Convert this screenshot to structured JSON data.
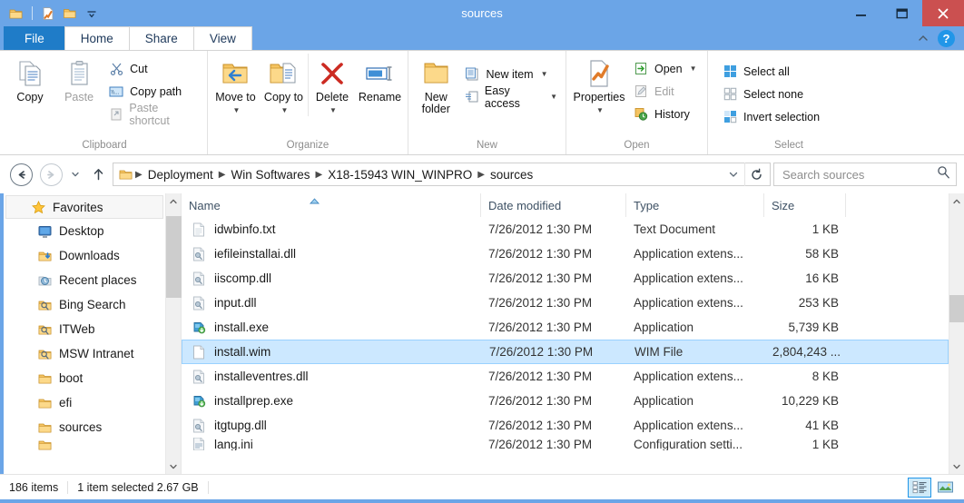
{
  "window": {
    "title": "sources",
    "quick_access": [
      "folder-icon",
      "properties-icon",
      "new-folder-icon",
      "qat-dropdown-icon"
    ],
    "controls": {
      "minimize": "minimize-icon",
      "maximize": "maximize-icon",
      "close": "close-icon"
    }
  },
  "ribbon": {
    "tabs": [
      {
        "label": "File",
        "active": false
      },
      {
        "label": "Home",
        "active": true
      },
      {
        "label": "Share",
        "active": false
      },
      {
        "label": "View",
        "active": false
      }
    ],
    "collapse_icon": "chevron-up-icon",
    "help_icon": "question-mark-icon",
    "groups": {
      "clipboard": {
        "label": "Clipboard",
        "copy": "Copy",
        "paste": "Paste",
        "cut": "Cut",
        "copy_path": "Copy path",
        "paste_shortcut": "Paste shortcut"
      },
      "organize": {
        "label": "Organize",
        "move_to": "Move to",
        "copy_to": "Copy to",
        "delete": "Delete",
        "rename": "Rename"
      },
      "new": {
        "label": "New",
        "new_folder": "New folder",
        "new_item": "New item",
        "easy_access": "Easy access"
      },
      "open": {
        "label": "Open",
        "properties": "Properties",
        "open": "Open",
        "edit": "Edit",
        "history": "History"
      },
      "select": {
        "label": "Select",
        "select_all": "Select all",
        "select_none": "Select none",
        "invert_selection": "Invert selection"
      }
    }
  },
  "address_bar": {
    "back": "back-icon",
    "forward": "forward-icon",
    "recent_dropdown": "history-dropdown-icon",
    "up": "up-icon",
    "breadcrumbs": [
      "Deployment",
      "Win Softwares",
      "X18-15943 WIN_WINPRO",
      "sources"
    ],
    "dropdown_icon": "chevron-down-icon",
    "refresh_icon": "refresh-icon",
    "search": {
      "placeholder": "Search sources",
      "value": "",
      "icon": "search-icon"
    }
  },
  "nav_pane": {
    "items": [
      {
        "label": "Favorites",
        "icon": "star-icon",
        "level": "root"
      },
      {
        "label": "Desktop",
        "icon": "desktop-icon",
        "level": "child"
      },
      {
        "label": "Downloads",
        "icon": "downloads-folder-icon",
        "level": "child"
      },
      {
        "label": "Recent places",
        "icon": "recent-places-icon",
        "level": "child"
      },
      {
        "label": "Bing Search",
        "icon": "search-folder-icon",
        "level": "child"
      },
      {
        "label": "ITWeb",
        "icon": "search-folder-icon",
        "level": "child"
      },
      {
        "label": "MSW Intranet",
        "icon": "search-folder-icon",
        "level": "child"
      },
      {
        "label": "boot",
        "icon": "folder-icon",
        "level": "child"
      },
      {
        "label": "efi",
        "icon": "folder-icon",
        "level": "child"
      },
      {
        "label": "sources",
        "icon": "folder-icon",
        "level": "child"
      }
    ]
  },
  "file_list": {
    "columns": [
      "Name",
      "Date modified",
      "Type",
      "Size"
    ],
    "sort": {
      "column": "Name",
      "direction": "ascending"
    },
    "rows": [
      {
        "name": "idwbinfo.txt",
        "date": "7/26/2012 1:30 PM",
        "type": "Text Document",
        "size": "1 KB",
        "icon": "text-file-icon",
        "selected": false
      },
      {
        "name": "iefileinstallai.dll",
        "date": "7/26/2012 1:30 PM",
        "type": "Application extens...",
        "size": "58 KB",
        "icon": "dll-file-icon",
        "selected": false
      },
      {
        "name": "iiscomp.dll",
        "date": "7/26/2012 1:30 PM",
        "type": "Application extens...",
        "size": "16 KB",
        "icon": "dll-file-icon",
        "selected": false
      },
      {
        "name": "input.dll",
        "date": "7/26/2012 1:30 PM",
        "type": "Application extens...",
        "size": "253 KB",
        "icon": "dll-file-icon",
        "selected": false
      },
      {
        "name": "install.exe",
        "date": "7/26/2012 1:30 PM",
        "type": "Application",
        "size": "5,739 KB",
        "icon": "exe-file-icon",
        "selected": false
      },
      {
        "name": "install.wim",
        "date": "7/26/2012 1:30 PM",
        "type": "WIM File",
        "size": "2,804,243 ...",
        "icon": "generic-file-icon",
        "selected": true
      },
      {
        "name": "installeventres.dll",
        "date": "7/26/2012 1:30 PM",
        "type": "Application extens...",
        "size": "8 KB",
        "icon": "dll-file-icon",
        "selected": false
      },
      {
        "name": "installprep.exe",
        "date": "7/26/2012 1:30 PM",
        "type": "Application",
        "size": "10,229 KB",
        "icon": "exe-file-icon",
        "selected": false
      },
      {
        "name": "itgtupg.dll",
        "date": "7/26/2012 1:30 PM",
        "type": "Application extens...",
        "size": "41 KB",
        "icon": "dll-file-icon",
        "selected": false
      },
      {
        "name": "lang.ini",
        "date": "7/26/2012 1:30 PM",
        "type": "Configuration setti...",
        "size": "1 KB",
        "icon": "ini-file-icon",
        "selected": false
      }
    ]
  },
  "status_bar": {
    "item_count": "186 items",
    "selection": "1 item selected",
    "selection_size": "2.67 GB",
    "views": [
      {
        "name": "details-view",
        "active": true
      },
      {
        "name": "large-icons-view",
        "active": false
      }
    ]
  },
  "colors": {
    "titlebar": "#6ba5e7",
    "file_tab": "#1f7cc8",
    "close_button": "#cb5050",
    "selection": "#cce8ff",
    "accent": "#2196e8"
  }
}
